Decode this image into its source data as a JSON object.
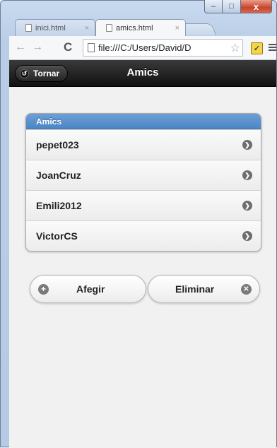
{
  "browser": {
    "tabs": [
      {
        "label": "inici.html",
        "active": false
      },
      {
        "label": "amics.html",
        "active": true
      }
    ],
    "close_glyph": "×",
    "address": "file:///C:/Users/David/D",
    "icons": {
      "back": "arrow-left-icon",
      "forward": "arrow-right-icon",
      "reload": "reload-icon",
      "bookmark": "star-icon",
      "extension": "extension-icon",
      "menu": "hamburger-menu-icon"
    }
  },
  "window_controls": {
    "minimize": "–",
    "maximize": "□",
    "close": "x"
  },
  "header": {
    "back_label": "Tornar",
    "title": "Amics"
  },
  "list": {
    "divider": "Amics",
    "items": [
      "pepet023",
      "JoanCruz",
      "Emili2012",
      "VictorCS"
    ]
  },
  "buttons": {
    "add_label": "Afegir",
    "delete_label": "Eliminar"
  },
  "colors": {
    "header_bg": "#1f1f1f",
    "divider_bg": "#5a93cf",
    "page_bg": "#f1f1f1"
  }
}
